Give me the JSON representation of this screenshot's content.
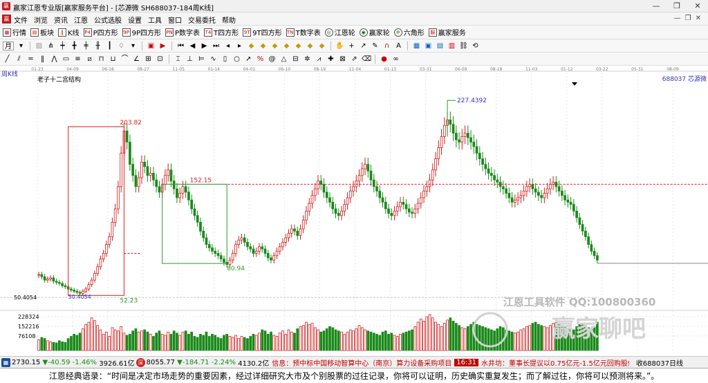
{
  "window": {
    "title": "赢家江恩专业版[赢家服务平台] - [芯源微  SH688037-184周K线]",
    "minimize": "—",
    "restore": "❐",
    "close": "✕"
  },
  "menu": {
    "items": [
      "文件",
      "浏览",
      "资讯",
      "江恩",
      "公式选股",
      "设置",
      "工具",
      "窗口",
      "交易委托",
      "帮助"
    ]
  },
  "toolbar1": {
    "items": [
      {
        "label": "行情",
        "icon": "grid"
      },
      {
        "label": "板块",
        "icon": "blocks"
      },
      {
        "label": "K线",
        "icon": "candles"
      },
      {
        "label": "P四方形",
        "icon": "P4"
      },
      {
        "label": "9P四方形",
        "icon": "9P"
      },
      {
        "label": "P数字表",
        "icon": "PN"
      },
      {
        "label": "T四方形",
        "icon": "T4"
      },
      {
        "label": "9T四方形",
        "icon": "9T"
      },
      {
        "label": "T数字表",
        "icon": "TN"
      },
      {
        "label": "江恩轮",
        "icon": "wheel"
      },
      {
        "label": "赢家轮",
        "icon": "wheel2"
      },
      {
        "label": "六角形",
        "icon": "hex"
      },
      {
        "label": "赢家服务",
        "icon": "service"
      }
    ]
  },
  "toolbar2": {
    "period_label": "月"
  },
  "chart_data": {
    "type": "candlestick",
    "period_label": "周K线",
    "indicator_label": "老子十二宫结构",
    "stock_label": "688037 芯源微",
    "dates": [
      "01-23",
      "04-09",
      "06-18",
      "08-27",
      "11-05",
      "01-14",
      "04-01",
      "06-10",
      "08-19",
      "11-04",
      "01-13",
      "03-31",
      "06-09",
      "08-18",
      "11-03",
      "01-12",
      "03-22",
      "05-31",
      "08-09"
    ],
    "ylim": [
      40,
      240
    ],
    "price_axis_label": "50.4054",
    "volume_axis_labels": [
      "228324",
      "152216",
      "76108"
    ],
    "start_price": 50.4054,
    "annotations": [
      {
        "text": "203.82",
        "price": 203.82
      },
      {
        "text": "52.23",
        "price": 52.23
      },
      {
        "text": "152.15",
        "price": 152.15
      },
      {
        "text": "80.94",
        "price": 80.94
      },
      {
        "text": "227.4392",
        "price": 227.4392
      },
      {
        "text": "50.4054",
        "price": 50.4054
      }
    ],
    "closes": [
      71,
      69,
      66,
      67,
      68,
      65,
      64,
      63,
      61,
      60,
      58,
      57,
      56,
      55,
      54,
      56,
      58,
      62,
      66,
      72,
      78,
      85,
      90,
      98,
      105,
      118,
      130,
      150,
      180,
      200,
      190,
      170,
      160,
      150,
      158,
      172,
      168,
      160,
      162,
      156,
      150,
      145,
      152,
      160,
      165,
      155,
      148,
      140,
      144,
      150,
      145,
      138,
      130,
      124,
      118,
      110,
      104,
      98,
      95,
      92,
      90,
      88,
      85,
      82,
      80,
      84,
      90,
      98,
      102,
      104,
      100,
      96,
      94,
      90,
      92,
      96,
      94,
      90,
      86,
      84,
      88,
      92,
      96,
      100,
      104,
      108,
      112,
      110,
      106,
      112,
      120,
      128,
      135,
      142,
      148,
      155,
      152,
      145,
      140,
      136,
      130,
      126,
      124,
      128,
      134,
      140,
      146,
      150,
      155,
      160,
      166,
      170,
      164,
      156,
      150,
      146,
      140,
      136,
      130,
      126,
      124,
      128,
      132,
      136,
      134,
      130,
      127,
      126,
      130,
      135,
      140,
      146,
      150,
      156,
      165,
      175,
      185,
      195,
      205,
      210,
      206,
      198,
      192,
      190,
      195,
      198,
      194,
      190,
      186,
      180,
      175,
      170,
      166,
      162,
      160,
      156,
      154,
      150,
      148,
      144,
      140,
      136,
      138,
      140,
      142,
      146,
      150,
      152,
      148,
      145,
      142,
      140,
      144,
      148,
      152,
      154,
      150,
      146,
      142,
      138,
      136,
      134,
      128,
      122,
      116,
      110,
      105,
      98,
      92,
      88,
      84
    ],
    "volumes": [
      20,
      24,
      22,
      18,
      16,
      15,
      14,
      18,
      16,
      15,
      22,
      26,
      30,
      28,
      32,
      40,
      48,
      52,
      60,
      55,
      46,
      38,
      30,
      34,
      26,
      42,
      38,
      36,
      44,
      32,
      28,
      30,
      36,
      40,
      34,
      36,
      38,
      34,
      30,
      26,
      32,
      36,
      30,
      28,
      34,
      30,
      36,
      32,
      28,
      34,
      36,
      30,
      34,
      26,
      24,
      30,
      28,
      34,
      26,
      30,
      28,
      24,
      22,
      28,
      30,
      26,
      24,
      28,
      22,
      26,
      24,
      22,
      26,
      30,
      28,
      32,
      38,
      36,
      30,
      34,
      28,
      26,
      32,
      36,
      30,
      38,
      34,
      32,
      40,
      44,
      46,
      52,
      48,
      50,
      42,
      38,
      34,
      36,
      40,
      44,
      42,
      38,
      36,
      34,
      30,
      34,
      38,
      36,
      40,
      46,
      42,
      38,
      36,
      34,
      32,
      30,
      28,
      34,
      36,
      30,
      32,
      28,
      26,
      30,
      32,
      34,
      36,
      38,
      44,
      52,
      58,
      54,
      62,
      66,
      60,
      52,
      48,
      44,
      50,
      56,
      60,
      54,
      50,
      46,
      42,
      40,
      44,
      48,
      52,
      48,
      46,
      44,
      42,
      40,
      38,
      36,
      40,
      44,
      42,
      38,
      36,
      34,
      32,
      34,
      38,
      40,
      44,
      46,
      50,
      52,
      48,
      46,
      44,
      42,
      46,
      50,
      52,
      48,
      46,
      44,
      42,
      40,
      38,
      44,
      48,
      50,
      46,
      42,
      40,
      44,
      52,
      56,
      60
    ]
  },
  "watermark": {
    "brand": "江恩工具软件  QQ:100800360",
    "forum": "赢家聊吧"
  },
  "statusbar": {
    "sh_value": "2730.15",
    "sh_change": "▼-40.59",
    "sh_pct": "-1.46%",
    "sh_amount": "3926.61亿",
    "sz_value": "8055.77",
    "sz_change": "▼-184.71",
    "sz_pct": "-2.24%",
    "sz_amount": "4130.2亿",
    "news1": "信息：预中标中国移动智算中心（南京）算力设备采购项目",
    "news_time": "16:31",
    "news2": "水井坊：董事长提议以0.75亿元-1.5亿元回购股份",
    "right_label": "收688037日线"
  },
  "quote": "江恩经典语录：“时间是决定市场走势的重要因素，经过详细研究大市及个别股票的过往记录，你将可以证明，历史确实重复发生；而了解过往，你将可以预测将来。”。",
  "colors": {
    "up": "#d21e1e",
    "down": "#1a8a1a",
    "annotation_red": "#e02020",
    "annotation_green": "#2a9a2a",
    "annotation_blue": "#3333bb",
    "grid": "#e6e6e6",
    "date_text": "#7a7a7a",
    "news": "#c00000"
  }
}
